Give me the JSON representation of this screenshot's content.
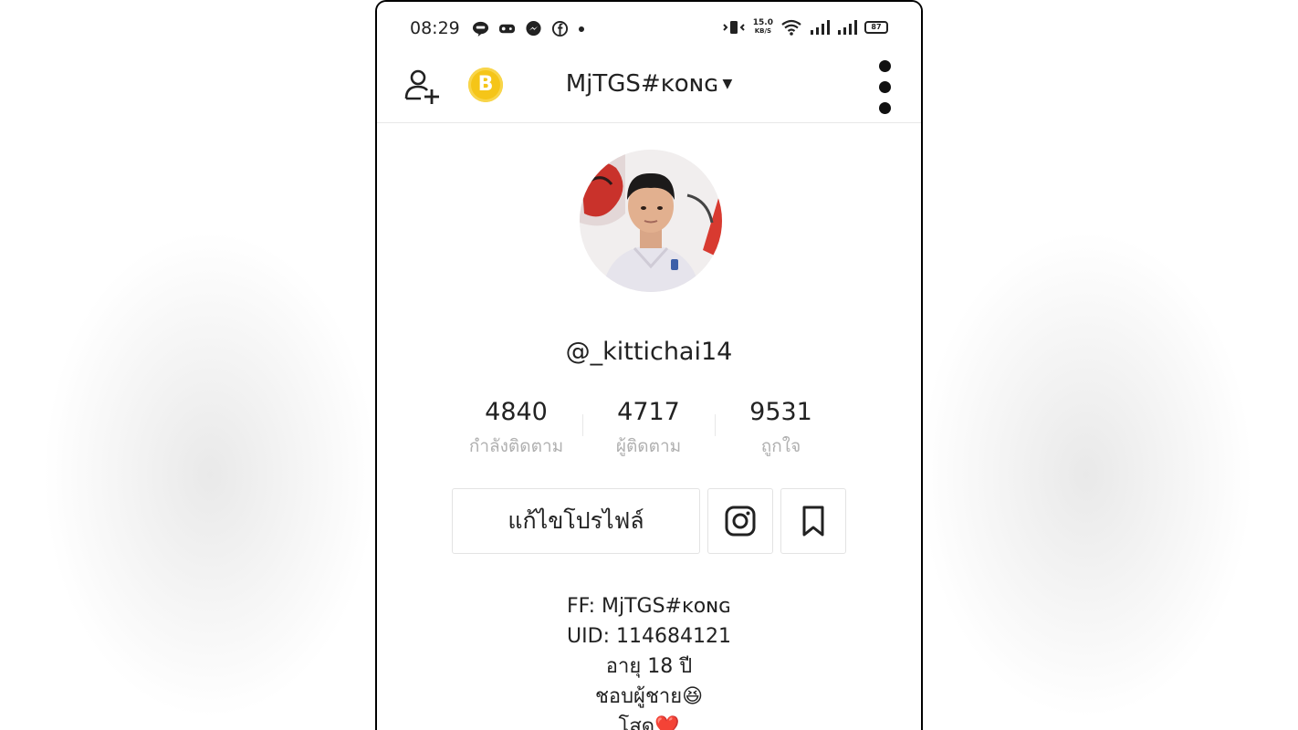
{
  "status_bar": {
    "time": "08:29",
    "net_speed": [
      "15.0",
      "KB/S"
    ],
    "battery": "87"
  },
  "header": {
    "account_name": "MjTGS#ᴋᴏɴɢ",
    "coin_letter": "B",
    "icons": [
      "add-user-icon",
      "coin-icon",
      "caret-down-icon",
      "more-vertical-icon"
    ]
  },
  "profile": {
    "username": "@_kittichai14",
    "stats": [
      {
        "value": "4840",
        "label": "กำลังติดตาม"
      },
      {
        "value": "4717",
        "label": "ผู้ติดตาม"
      },
      {
        "value": "9531",
        "label": "ถูกใจ"
      }
    ],
    "edit_button": "แก้ไขโปรไฟล์",
    "bio": [
      "FF: MjTGS#ᴋᴏɴɢ",
      "UID: 114684121",
      "อายุ 18 ปี",
      "ชอบผู้ชาย😆",
      "โสด❤️"
    ]
  },
  "colors": {
    "coin": "#f5c518",
    "text": "#222222",
    "muted": "#b0b0b0",
    "border": "#e3e3e3"
  }
}
